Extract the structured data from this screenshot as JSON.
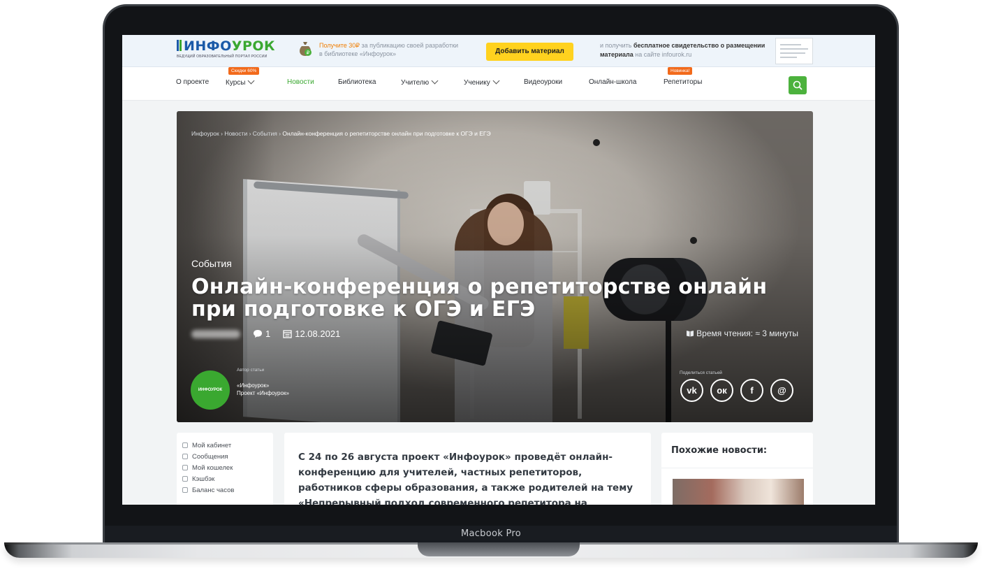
{
  "device": {
    "label": "Macbook Pro"
  },
  "promo": {
    "logo_text_blue": "ИНФО",
    "logo_text_green": "УРОК",
    "logo_tagline": "ВЕДУЩИЙ ОБРАЗОВАТЕЛЬНЫЙ ПОРТАЛ РОССИИ",
    "offer_highlight": "Получите 30₽",
    "offer_text": " за публикацию своей разработки в библиотеке «Инфоурок»",
    "add_button": "Добавить материал",
    "cert_pre": "и получить ",
    "cert_bold1": "бесплатное свидетельство о размещении материала",
    "cert_post": " на сайте infourok.ru"
  },
  "nav": {
    "items": [
      {
        "label": "О проекте"
      },
      {
        "label": "Курсы",
        "badge": "Скидки 60%"
      },
      {
        "label": "Новости"
      },
      {
        "label": "Библиотека"
      },
      {
        "label": "Учителю"
      },
      {
        "label": "Ученику"
      },
      {
        "label": "Видеоуроки"
      },
      {
        "label": "Онлайн-школа"
      },
      {
        "label": "Репетиторы",
        "badge": "Новинка!"
      }
    ],
    "active": "Новости"
  },
  "hero": {
    "breadcrumb": {
      "prefix": "Инфоурок › Новости › События › ",
      "current": "Онлайн-конференция о репетиторстве онлайн при подготовке к ОГЭ и ЕГЭ"
    },
    "category": "События",
    "title": "Онлайн-конференция о репетиторстве онлайн при подготовке к ОГЭ и ЕГЭ",
    "comments": "1",
    "date": "12.08.2021",
    "reading_time": "Время чтения: ≈ 3 минуты",
    "author_caption": "Автор статьи",
    "author_name": "«Инфоурок»",
    "author_role": "Проект «Инфоурок»",
    "author_logo": "ИНФОУРОК",
    "share_caption": "Поделиться статьей",
    "share": [
      {
        "icon": "vk-icon",
        "glyph": "vk"
      },
      {
        "icon": "odnoklassniki-icon",
        "glyph": "ок"
      },
      {
        "icon": "facebook-icon",
        "glyph": "f"
      },
      {
        "icon": "email-icon",
        "glyph": "@"
      }
    ]
  },
  "side_menu": [
    {
      "label": "Мой кабинет"
    },
    {
      "label": "Сообщения"
    },
    {
      "label": "Мой кошелек"
    },
    {
      "label": "Кэшбэк"
    },
    {
      "label": "Баланс часов"
    }
  ],
  "article": {
    "lead": "С 24 по 26 августа проект «Инфоурок» проведёт онлайн-конференцию для учителей, частных репетиторов, работников сферы образования, а также родителей на тему «Непрерывный подход современного репетитора на"
  },
  "similar": {
    "title": "Похожие новости:"
  },
  "colors": {
    "brand_green": "#3aa830",
    "brand_blue": "#1b5aa8",
    "badge_orange": "#f26a1b",
    "button_yellow": "#ffd21f"
  }
}
